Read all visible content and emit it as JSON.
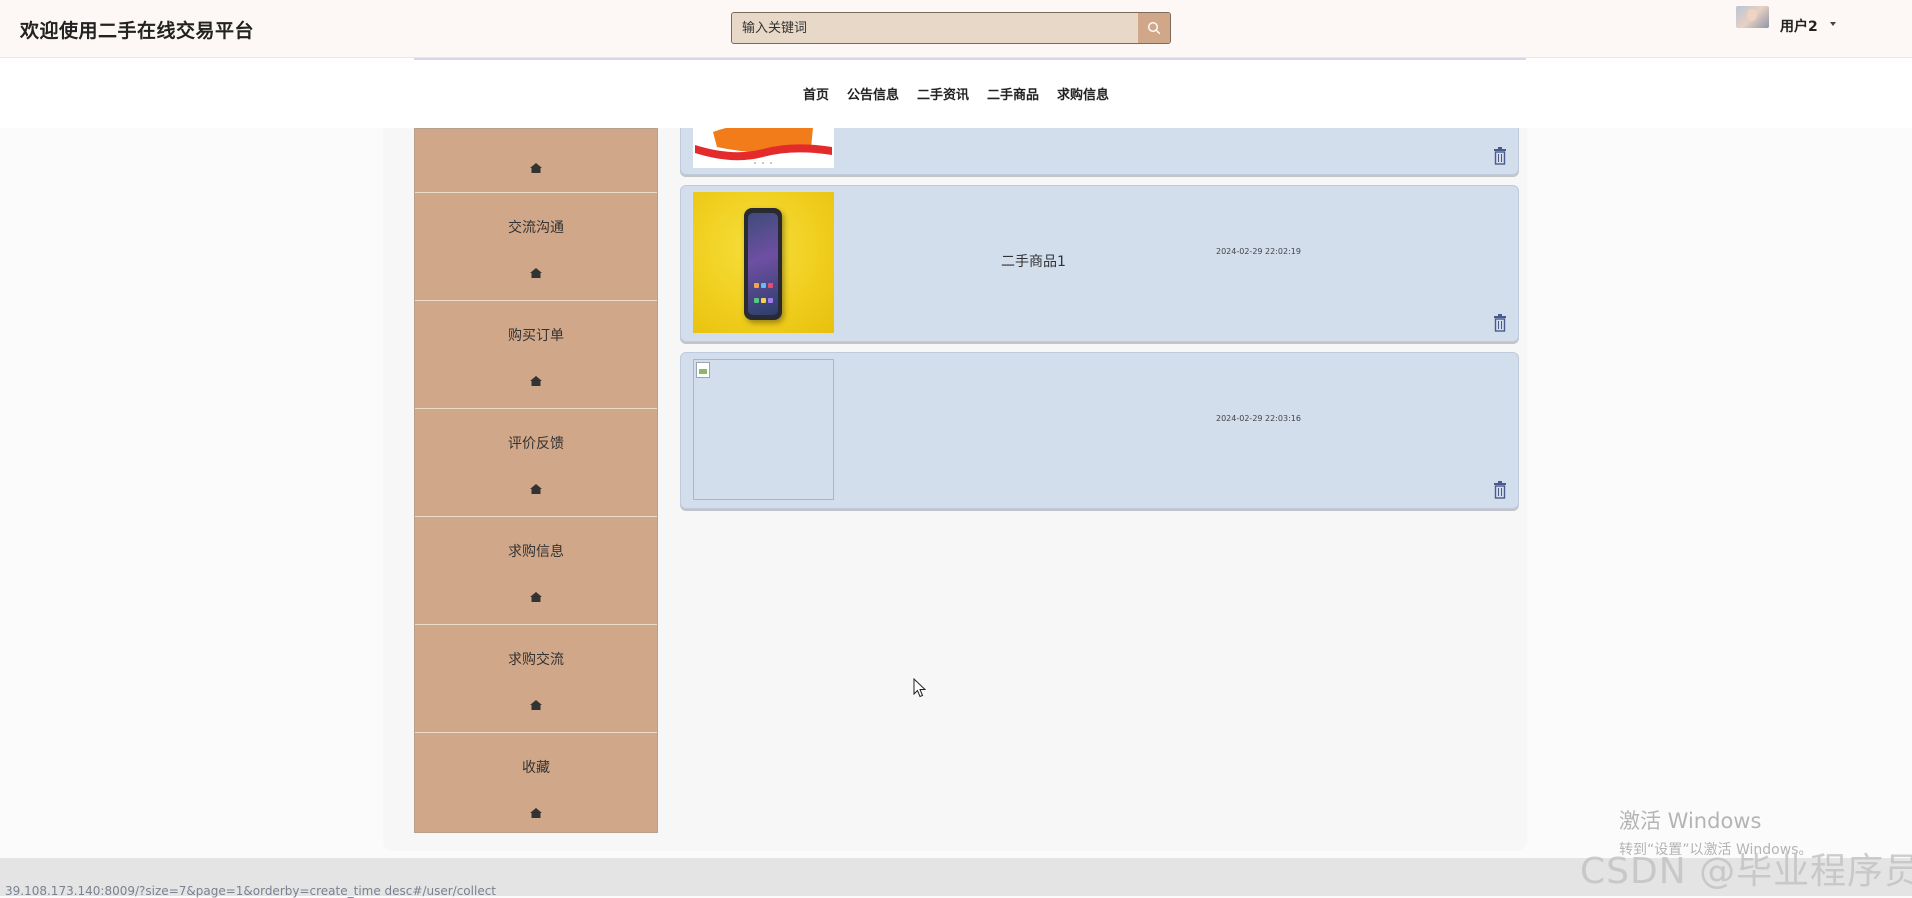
{
  "header": {
    "title": "欢迎使用二手在线交易平台",
    "search_placeholder": "输入关键词",
    "username": "用户2"
  },
  "nav": {
    "items": [
      "首页",
      "公告信息",
      "二手资讯",
      "二手商品",
      "求购信息"
    ]
  },
  "sidebar": {
    "items": [
      "交流沟通",
      "购买订单",
      "评价反馈",
      "求购信息",
      "求购交流",
      "收藏"
    ]
  },
  "cards": [
    {
      "title": "",
      "time": ""
    },
    {
      "title": "二手商品1",
      "time": "2024-02-29 22:02:19"
    },
    {
      "title": "",
      "time": "2024-02-29 22:03:16"
    }
  ],
  "status": {
    "url": "39.108.173.140:8009/?size=7&page=1&orderby=create_time desc#/user/collect"
  },
  "os_overlay": {
    "activate_title": "激活 Windows",
    "activate_hint": "转到“设置”以激活 Windows。",
    "watermark": "CSDN @毕业程序员"
  },
  "colors": {
    "accent": "#d1a789",
    "card": "#d3deed",
    "sidebar": "#d1a789"
  }
}
